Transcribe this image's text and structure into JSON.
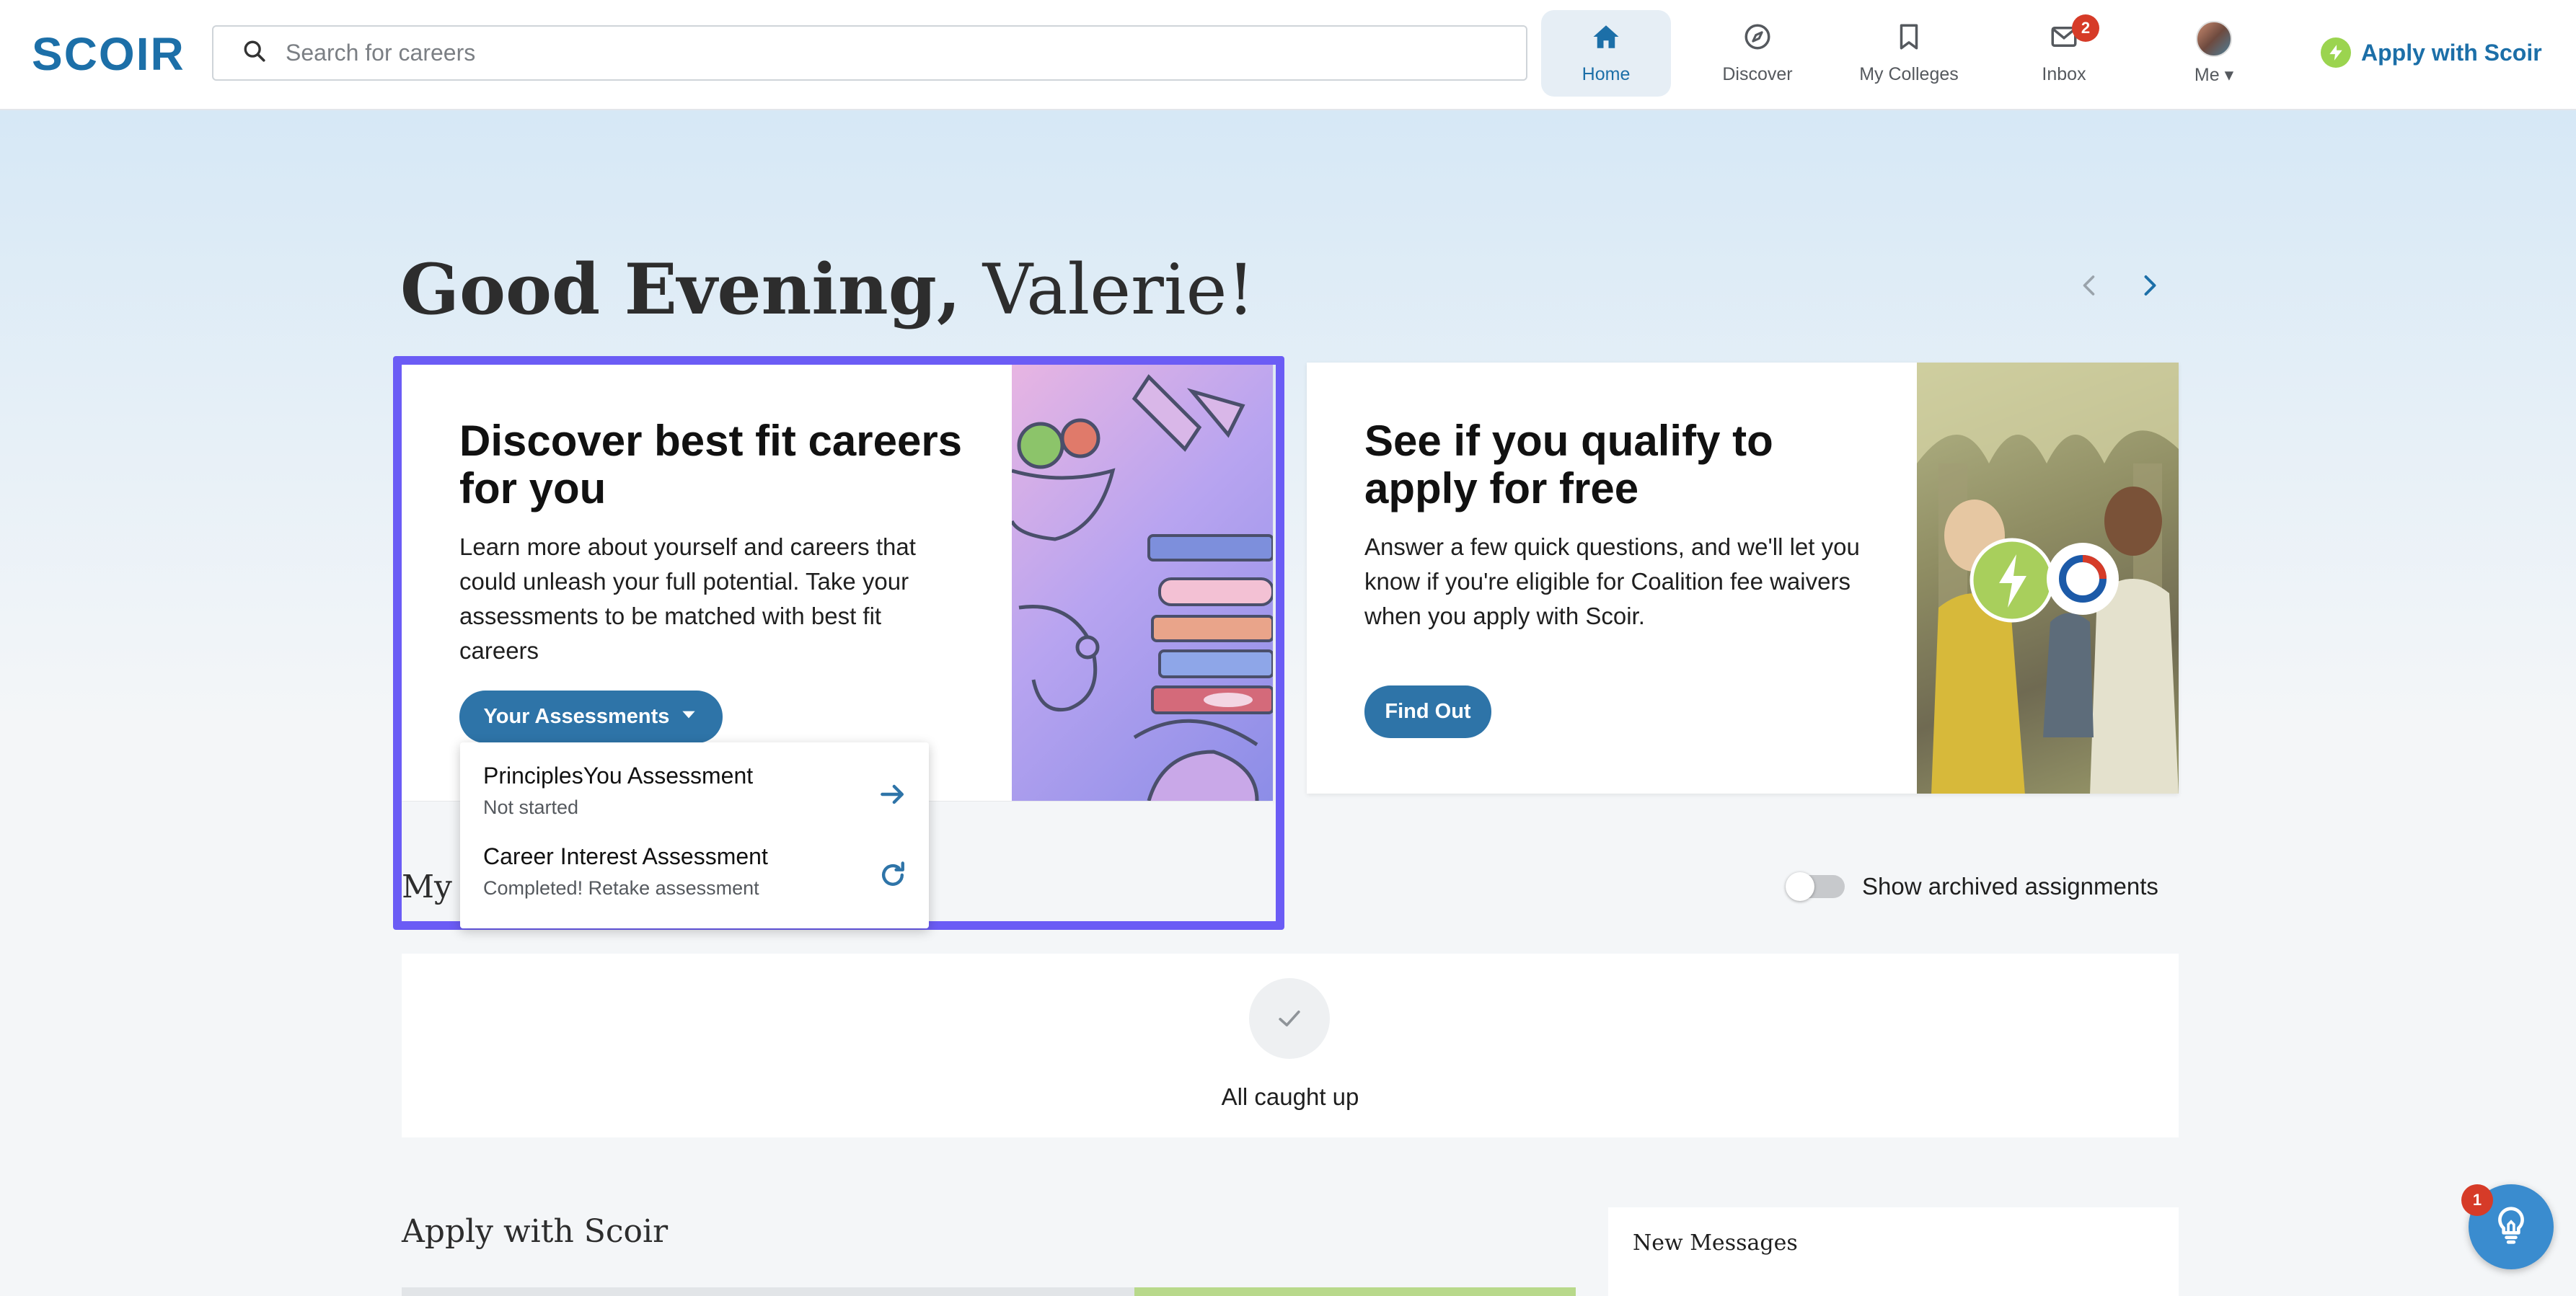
{
  "brand": {
    "logo_text": "SCOIR"
  },
  "search": {
    "placeholder": "Search for careers"
  },
  "nav": {
    "home": "Home",
    "discover": "Discover",
    "my_colleges": "My Colleges",
    "inbox": "Inbox",
    "inbox_count": "2",
    "me": "Me",
    "me_caret": "▾",
    "apply": "Apply with Scoir"
  },
  "greeting": {
    "salutation": "Good Evening,",
    "name": " Valerie!"
  },
  "cards": [
    {
      "title": "Discover best fit careers for you",
      "text": "Learn more about yourself and careers that could unleash your full potential. Take your assessments to be matched with best fit careers",
      "button": "Your Assessments"
    },
    {
      "title": "See if you qualify to apply for free",
      "text": "Answer a few quick questions, and we'll let you know if you're eligible for Coalition fee waivers when you apply with Scoir.",
      "button": "Find Out"
    }
  ],
  "assessments_menu": [
    {
      "title": "PrinciplesYou Assessment",
      "status": "Not started",
      "icon": "arrow-right-icon"
    },
    {
      "title": "Career Interest Assessment",
      "status": "Completed! Retake assessment",
      "icon": "refresh-icon"
    }
  ],
  "assignments": {
    "heading": "My Assignments",
    "toggle_label": "Show archived assignments",
    "toggle_on": false,
    "empty_text": "All caught up"
  },
  "apply_section": {
    "heading": "Apply with Scoir"
  },
  "messages": {
    "title": "New Messages"
  },
  "help": {
    "badge_count": "1"
  },
  "colors": {
    "brand_blue": "#1c6fa8",
    "button_blue": "#2e74a8",
    "highlight": "#6b5cf5",
    "badge_red": "#d63b28",
    "bolt_green": "#9bd44f"
  }
}
